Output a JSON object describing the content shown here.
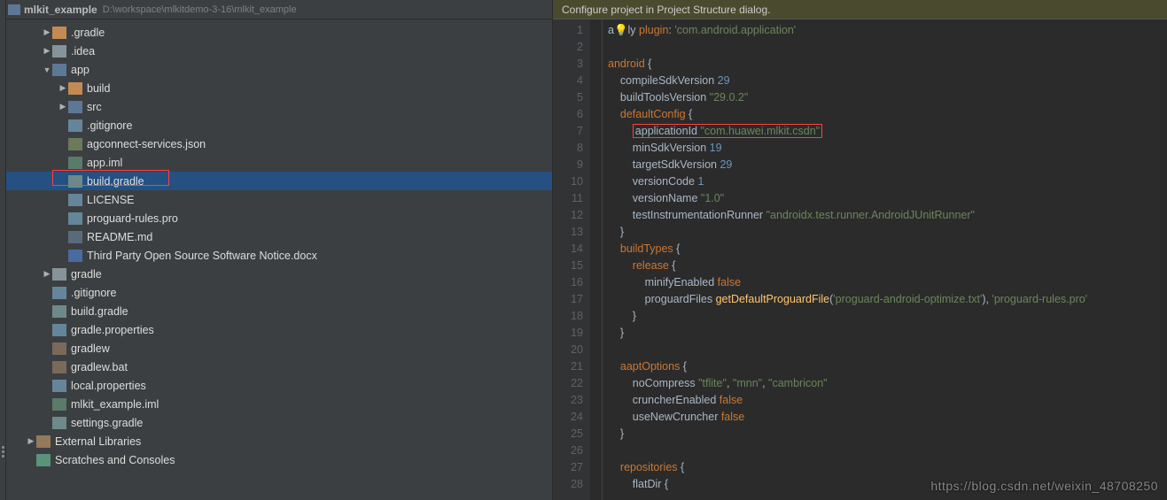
{
  "path_bar": {
    "name": "mlkit_example",
    "path": "D:\\workspace\\mlkitdemo-3-16\\mlkit_example"
  },
  "tree": [
    {
      "d": 0,
      "c": "down",
      "i": "folder-brown",
      "l": ".gradle"
    },
    {
      "d": 0,
      "c": "down",
      "i": "folder-gray",
      "l": ".idea"
    },
    {
      "d": 0,
      "c": "open",
      "i": "folder-blue",
      "l": "app"
    },
    {
      "d": 1,
      "c": "down",
      "i": "folder-brown",
      "l": "build"
    },
    {
      "d": 1,
      "c": "down",
      "i": "folder-blue",
      "l": "src"
    },
    {
      "d": 1,
      "c": "",
      "i": "file-text",
      "l": ".gitignore"
    },
    {
      "d": 1,
      "c": "",
      "i": "file-json",
      "l": "agconnect-services.json"
    },
    {
      "d": 1,
      "c": "",
      "i": "file-img",
      "l": "app.iml"
    },
    {
      "d": 1,
      "c": "",
      "i": "file-gradle",
      "l": "build.gradle",
      "sel": true
    },
    {
      "d": 1,
      "c": "",
      "i": "file-text",
      "l": "LICENSE"
    },
    {
      "d": 1,
      "c": "",
      "i": "file-text",
      "l": "proguard-rules.pro"
    },
    {
      "d": 1,
      "c": "",
      "i": "file-md",
      "l": "README.md"
    },
    {
      "d": 1,
      "c": "",
      "i": "file-doc",
      "l": "Third Party Open Source Software Notice.docx"
    },
    {
      "d": 0,
      "c": "down",
      "i": "folder-gray",
      "l": "gradle"
    },
    {
      "d": 0,
      "c": "",
      "i": "file-text",
      "l": ".gitignore"
    },
    {
      "d": 0,
      "c": "",
      "i": "file-gradle",
      "l": "build.gradle"
    },
    {
      "d": 0,
      "c": "",
      "i": "file-text",
      "l": "gradle.properties"
    },
    {
      "d": 0,
      "c": "",
      "i": "file-bat",
      "l": "gradlew"
    },
    {
      "d": 0,
      "c": "",
      "i": "file-bat",
      "l": "gradlew.bat"
    },
    {
      "d": 0,
      "c": "",
      "i": "file-text",
      "l": "local.properties"
    },
    {
      "d": 0,
      "c": "",
      "i": "file-img",
      "l": "mlkit_example.iml"
    },
    {
      "d": 0,
      "c": "",
      "i": "file-gradle",
      "l": "settings.gradle"
    },
    {
      "d": -1,
      "c": "down",
      "i": "file-lib",
      "l": "External Libraries"
    },
    {
      "d": -1,
      "c": "",
      "i": "file-scratch",
      "l": "Scratches and Consoles"
    }
  ],
  "banner": "Configure project in Project Structure dialog.",
  "line_count": 28,
  "code": [
    {
      "t": "apply",
      "pre": "a<span class='bulb'>💡</span>ly ",
      "rest": "<span class='kw'>plugin</span>: <span class='str'>'com.android.application'</span>"
    },
    {
      "t": "blank",
      "rest": ""
    },
    {
      "t": "android",
      "rest": "<span class='kw'>android</span> {"
    },
    {
      "t": "compile",
      "rest": "    compileSdkVersion <span class='num'>29</span>"
    },
    {
      "t": "buildtools",
      "rest": "    buildToolsVersion <span class='str'>\"29.0.2\"</span>"
    },
    {
      "t": "default",
      "rest": "    <span class='kw'>defaultConfig</span> {"
    },
    {
      "t": "appid",
      "rest": "        <span class='hl'>applicationId <span class='str'>\"com.huawei.mlkit.csdn\"</span></span>"
    },
    {
      "t": "minsdk",
      "rest": "        minSdkVersion <span class='num'>19</span>"
    },
    {
      "t": "targetsdk",
      "rest": "        targetSdkVersion <span class='num'>29</span>"
    },
    {
      "t": "vcode",
      "rest": "        versionCode <span class='num'>1</span>"
    },
    {
      "t": "vname",
      "rest": "        versionName <span class='str'>\"1.0\"</span>"
    },
    {
      "t": "testrunner",
      "rest": "        testInstrumentationRunner <span class='str'>\"androidx.test.runner.AndroidJUnitRunner\"</span>"
    },
    {
      "t": "close",
      "rest": "    }"
    },
    {
      "t": "buildtypes",
      "rest": "    <span class='kw'>buildTypes</span> {"
    },
    {
      "t": "release",
      "rest": "        <span class='kw'>release</span> {"
    },
    {
      "t": "minify",
      "rest": "            minifyEnabled <span class='kw'>false</span>"
    },
    {
      "t": "proguard",
      "rest": "            proguardFiles <span class='def'>getDefaultProguardFile</span>(<span class='str'>'proguard-android-optimize.txt'</span>), <span class='str'>'proguard-rules.pro'</span>"
    },
    {
      "t": "close",
      "rest": "        }"
    },
    {
      "t": "close",
      "rest": "    }"
    },
    {
      "t": "blank",
      "rest": ""
    },
    {
      "t": "aapt",
      "rest": "    <span class='kw'>aaptOptions</span> {"
    },
    {
      "t": "nocompress",
      "rest": "        noCompress <span class='str'>\"tflite\"</span>, <span class='str'>\"mnn\"</span>, <span class='str'>\"cambricon\"</span>"
    },
    {
      "t": "cruncher",
      "rest": "        cruncherEnabled <span class='kw'>false</span>"
    },
    {
      "t": "newcruncher",
      "rest": "        useNewCruncher <span class='kw'>false</span>"
    },
    {
      "t": "close",
      "rest": "    }"
    },
    {
      "t": "blank",
      "rest": ""
    },
    {
      "t": "repos",
      "rest": "    <span class='kw'>repositories</span> {"
    },
    {
      "t": "flatdir",
      "rest": "        flatDir {"
    }
  ],
  "watermark": "https://blog.csdn.net/weixin_48708250"
}
